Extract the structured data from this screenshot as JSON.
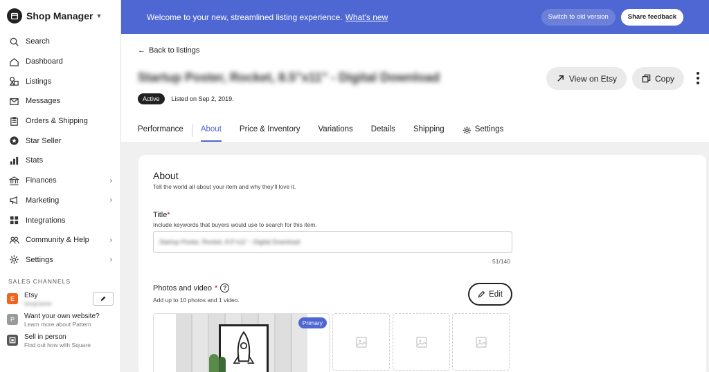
{
  "brand": {
    "title": "Shop Manager"
  },
  "sidebar": {
    "items": [
      {
        "label": "Search",
        "icon": "search-icon"
      },
      {
        "label": "Dashboard",
        "icon": "home-icon"
      },
      {
        "label": "Listings",
        "icon": "shapes-icon"
      },
      {
        "label": "Messages",
        "icon": "mail-icon"
      },
      {
        "label": "Orders & Shipping",
        "icon": "clipboard-icon"
      },
      {
        "label": "Star Seller",
        "icon": "star-badge-icon"
      },
      {
        "label": "Stats",
        "icon": "bar-chart-icon"
      },
      {
        "label": "Finances",
        "icon": "bank-icon"
      },
      {
        "label": "Marketing",
        "icon": "megaphone-icon"
      },
      {
        "label": "Integrations",
        "icon": "grid-icon"
      },
      {
        "label": "Community & Help",
        "icon": "people-icon"
      },
      {
        "label": "Settings",
        "icon": "gear-icon"
      }
    ],
    "section_label": "SALES CHANNELS",
    "channels": [
      {
        "badge": "E",
        "name": "Etsy",
        "sub": "shopname",
        "badge_color": "#f1641e"
      },
      {
        "badge": "P",
        "name": "Want your own website?",
        "sub": "Learn more about Pattern",
        "badge_color": "#9a9a9a"
      },
      {
        "badge": "",
        "name": "Sell in person",
        "sub": "Find out how with Square",
        "badge_color": "#555555"
      }
    ]
  },
  "banner": {
    "message": "Welcome to your new, streamlined listing experience.",
    "link": "What's new",
    "switch_label": "Switch to old version",
    "feedback_label": "Share feedback"
  },
  "header": {
    "back_label": "Back to listings",
    "listing_title": "Startup Poster, Rocket, 8.5\"x11\" - Digital Download",
    "status": "Active",
    "listed_on": "Listed on Sep 2, 2019.",
    "view_label": "View on Etsy",
    "copy_label": "Copy"
  },
  "tabs": [
    {
      "label": "Performance"
    },
    {
      "label": "About"
    },
    {
      "label": "Price & Inventory"
    },
    {
      "label": "Variations"
    },
    {
      "label": "Details"
    },
    {
      "label": "Shipping"
    },
    {
      "label": "Settings"
    }
  ],
  "about": {
    "heading": "About",
    "subtitle": "Tell the world all about your item and why they'll love it.",
    "title_label": "Title",
    "required_mark": "*",
    "title_hint": "Include keywords that buyers would use to search for this item.",
    "title_value": "Startup Poster, Rocket, 8.5\"x11\" - Digital Download",
    "char_count": "51/140",
    "photos_label": "Photos and video",
    "photos_hint": "Add up to 10 photos and 1 video.",
    "edit_label": "Edit",
    "primary_tag": "Primary"
  },
  "colors": {
    "accent": "#4f67d3",
    "required": "#a61a2e",
    "etsy_orange": "#f1641e"
  }
}
